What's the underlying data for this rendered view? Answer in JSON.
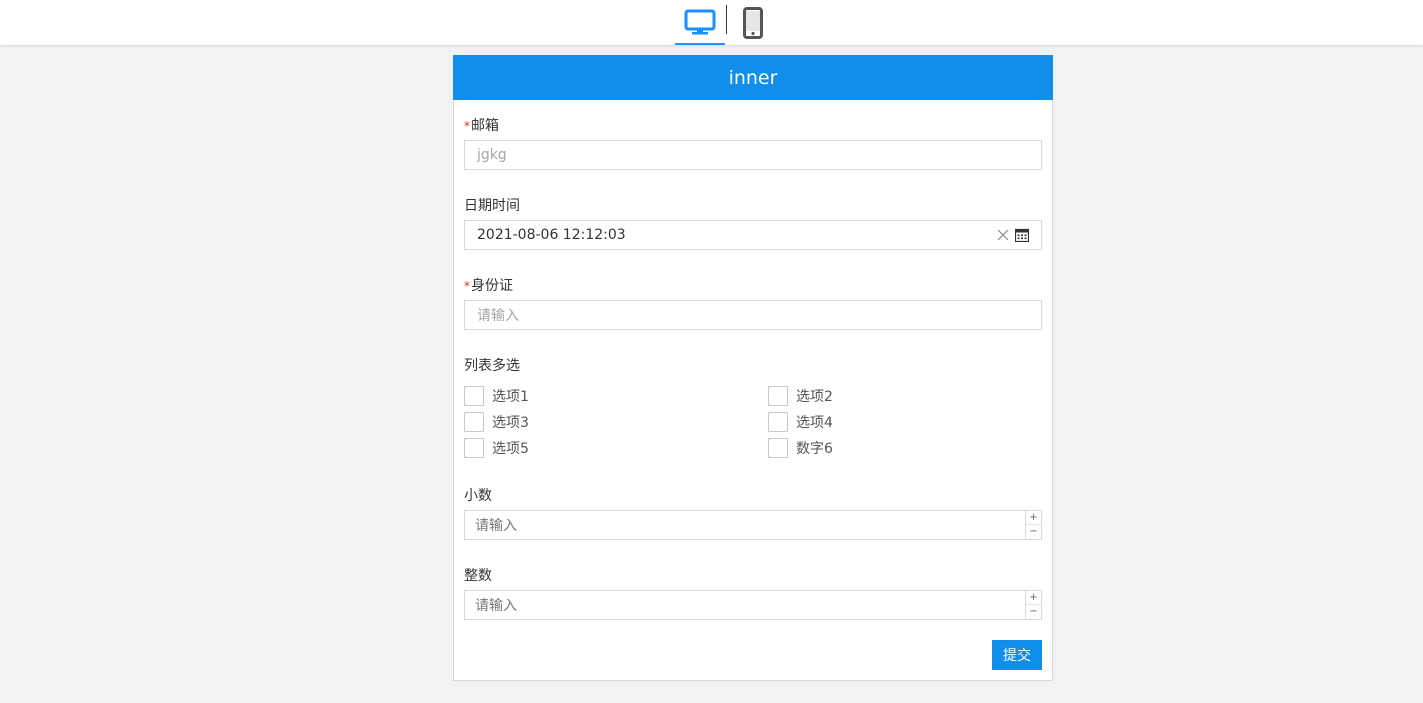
{
  "topbar": {
    "devices": [
      {
        "icon": "desktop-icon",
        "active": true
      },
      {
        "icon": "mobile-phone-icon",
        "active": false
      }
    ],
    "accent_color": "#1890ff"
  },
  "panel": {
    "title": "inner",
    "header_color": "#108ee9"
  },
  "form": {
    "email": {
      "label": "邮箱",
      "required_mark": "*",
      "placeholder": "jgkg"
    },
    "datetime": {
      "label": "日期时间",
      "value": "2021-08-06 12:12:03"
    },
    "id_card": {
      "label": "身份证",
      "required_mark": "*",
      "placeholder": "请输入"
    },
    "multi_select": {
      "label": "列表多选",
      "options": [
        "选项1",
        "选项2",
        "选项3",
        "选项4",
        "选项5",
        "数字6"
      ]
    },
    "decimal": {
      "label": "小数",
      "placeholder": "请输入",
      "plus": "+",
      "minus": "−"
    },
    "integer": {
      "label": "整数",
      "placeholder": "请输入",
      "plus": "+",
      "minus": "−"
    },
    "submit_label": "提交"
  }
}
